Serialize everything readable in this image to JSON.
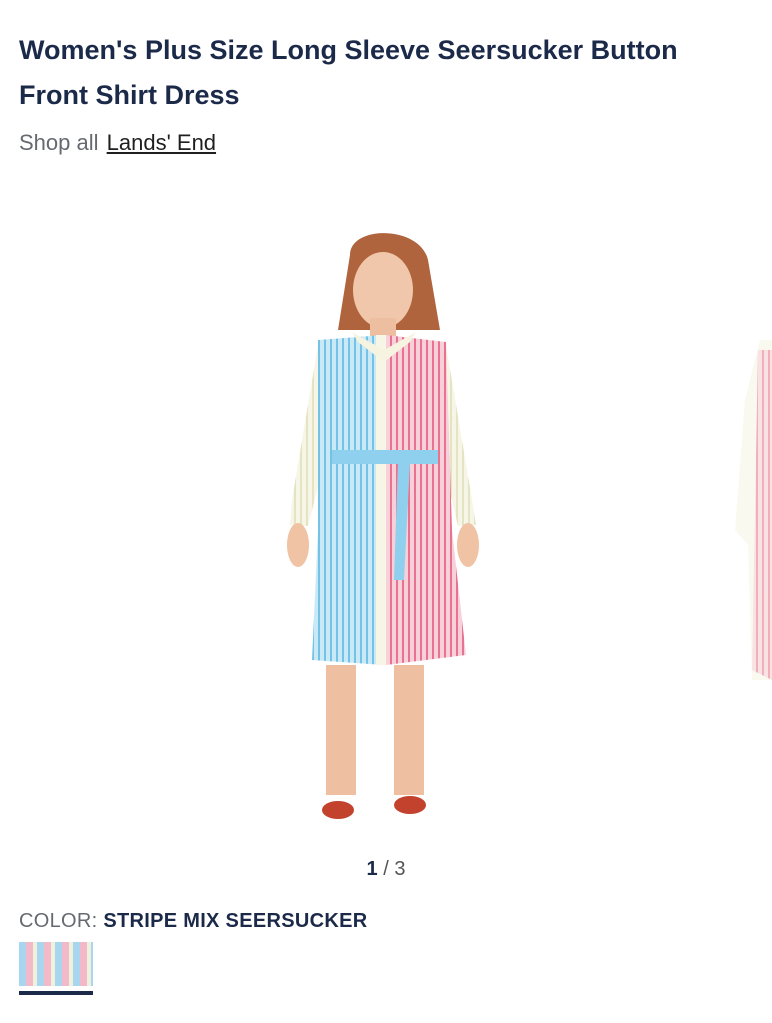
{
  "product": {
    "title": "Women's Plus Size Long Sleeve Seersucker Button Front Shirt Dress",
    "shop_all_prefix": "Shop all",
    "brand": "Lands' End"
  },
  "gallery": {
    "current": "1",
    "separator": "/",
    "total": "3"
  },
  "color": {
    "label": "COLOR:",
    "selected": "STRIPE MIX SEERSUCKER",
    "swatch_colors": [
      "#a9d6ef",
      "#f2b9c8",
      "#eef2dc"
    ]
  }
}
